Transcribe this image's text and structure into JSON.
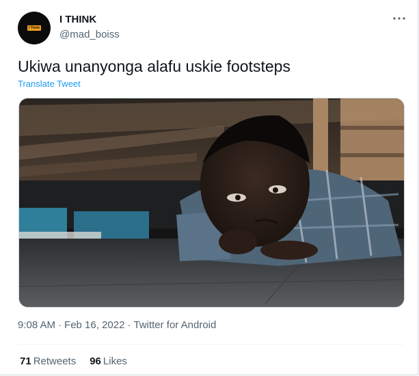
{
  "author": {
    "display_name": "I THINK",
    "handle": "@mad_boiss",
    "avatar_badge_text": "I Think"
  },
  "tweet": {
    "text": "Ukiwa unanyonga alafu uskie footsteps",
    "translate_label": "Translate Tweet",
    "time": "9:08 AM",
    "date": "Feb 16, 2022",
    "source": "Twitter for Android",
    "separator": "·"
  },
  "stats": {
    "retweets_count": "71",
    "retweets_label": "Retweets",
    "likes_count": "96",
    "likes_label": "Likes"
  },
  "icons": {
    "more": "more-horizontal-icon"
  },
  "colors": {
    "link": "#1d9bf0",
    "muted": "#536471",
    "text": "#0f1419",
    "border": "#cfd9de",
    "avatar_bg": "#0b0b0b",
    "avatar_badge": "#f0a01e"
  }
}
